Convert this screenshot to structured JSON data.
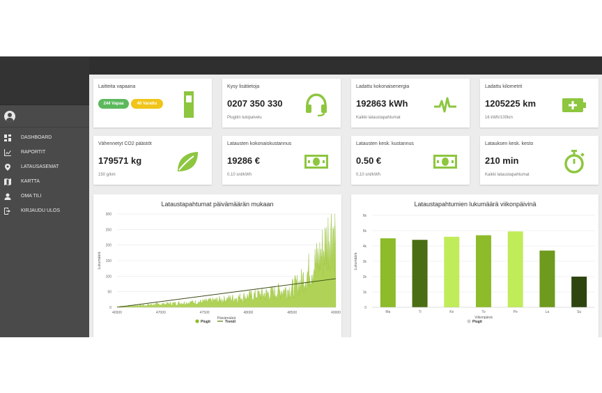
{
  "sidebar": {
    "items": [
      {
        "label": "DASHBOARD",
        "icon": "dashboard-icon"
      },
      {
        "label": "RAPORTIT",
        "icon": "chart-line-icon"
      },
      {
        "label": "LATAUSASEMAT",
        "icon": "location-pin-icon"
      },
      {
        "label": "KARTTA",
        "icon": "map-icon"
      },
      {
        "label": "OMA TILI",
        "icon": "person-icon"
      },
      {
        "label": "KIRJAUDU ULOS",
        "icon": "logout-icon"
      }
    ]
  },
  "cards": [
    {
      "title": "Laitteita vapaana",
      "badges": [
        "244 Vapaa",
        "40 Varattu"
      ],
      "icon": "charger-icon"
    },
    {
      "title": "Kysy lisätietoja",
      "value": "0207 350 330",
      "sub": "Plugitin tukipalvelu",
      "icon": "headset-icon"
    },
    {
      "title": "Ladattu kokonaisenergia",
      "value": "192863 kWh",
      "sub": "Kaikki lataustapahtumat",
      "icon": "pulse-icon"
    },
    {
      "title": "Ladattu kilometrit",
      "value": "1205225 km",
      "sub": "16 kWh/100km",
      "icon": "battery-plus-icon"
    },
    {
      "title": "Vähennetyt CO2 päästöt",
      "value": "179571 kg",
      "sub": "150 g/km",
      "icon": "leaf-icon"
    },
    {
      "title": "Latausten kokonaiskustannus",
      "value": "19286 €",
      "sub": "0,10 snt/kWh",
      "icon": "cash-icon"
    },
    {
      "title": "Latausten kesk. kustannus",
      "value": "0.50 €",
      "sub": "0,10 snt/kWh",
      "icon": "cash-icon"
    },
    {
      "title": "Latauksen kesk. kesto",
      "value": "210 min",
      "sub": "Kaikki lataustapahtumat",
      "icon": "stopwatch-icon"
    }
  ],
  "colors": {
    "green": "#8dc63f",
    "badge_green": "#5cb85c",
    "badge_yellow": "#f0c419",
    "sidebar": "#4a4a4a",
    "topbar": "#2f2f2f"
  },
  "chart_data": [
    {
      "type": "area",
      "title": "Lataustapahtumat päivämäärän mukaan",
      "xlabel": "Päivämäärä",
      "ylabel": "Lukumäärä",
      "ylim": [
        0,
        300
      ],
      "yticks": [
        0,
        50,
        100,
        150,
        200,
        250,
        300
      ],
      "xlim": [
        46500,
        49000
      ],
      "xticks": [
        "46500",
        "47000",
        "47500",
        "48000",
        "48500",
        "49000"
      ],
      "series": [
        {
          "name": "Plugit",
          "x": [
            46500,
            46750,
            47000,
            47250,
            47500,
            47750,
            48000,
            48250,
            48500,
            48600,
            48700,
            48800,
            48900,
            48950,
            49000
          ],
          "values": [
            3,
            6,
            10,
            14,
            18,
            26,
            35,
            45,
            60,
            80,
            120,
            150,
            210,
            270,
            230
          ]
        },
        {
          "name": "Trendi",
          "x": [
            46500,
            49000
          ],
          "values": [
            0,
            92
          ]
        }
      ],
      "legend": [
        "Plugit",
        "Trendi"
      ],
      "footer": "Highcharts.com"
    },
    {
      "type": "bar",
      "title": "Lataustapahtumien lukumäärä viikonpäivinä",
      "xlabel": "Viikonpäivä",
      "ylabel": "Lukumäärä",
      "ylim": [
        0,
        6000
      ],
      "yticks": [
        "0",
        "1k",
        "2k",
        "3k",
        "4k",
        "5k",
        "6k"
      ],
      "categories": [
        "Ma",
        "Ti",
        "Ke",
        "To",
        "Pe",
        "La",
        "Su"
      ],
      "series": [
        {
          "name": "Plugit",
          "values": [
            4500,
            4400,
            4600,
            4700,
            4950,
            3700,
            2000
          ]
        }
      ],
      "bar_colors": [
        "#8dbb2a",
        "#4a6e14",
        "#c0ec5a",
        "#8dbb2a",
        "#c0ec5a",
        "#6e9a1e",
        "#2e4510"
      ],
      "legend": [
        "Plugit"
      ],
      "footer": "Highcharts.com"
    }
  ]
}
